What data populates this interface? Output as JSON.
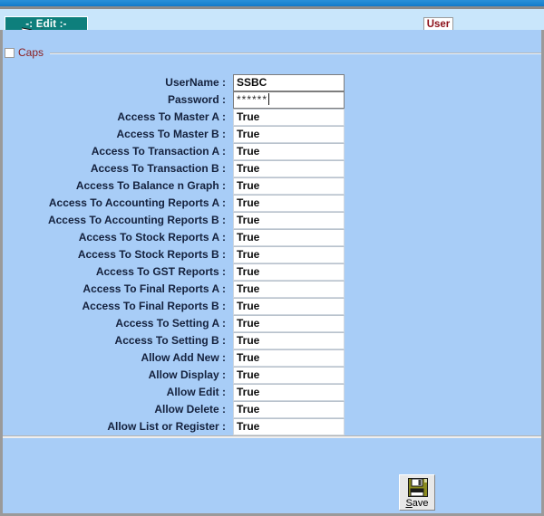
{
  "window": {
    "tab_label": "-: Edit :-",
    "entity_label": "User"
  },
  "group": {
    "caps_label": "Caps",
    "caps_checked": false
  },
  "form": {
    "fields": [
      {
        "label": "UserName :",
        "value": "SSBC",
        "type": "text"
      },
      {
        "label": "Password :",
        "value": "******",
        "type": "password"
      },
      {
        "label": "Access To Master A :",
        "value": "True",
        "type": "bool"
      },
      {
        "label": "Access To Master B :",
        "value": "True",
        "type": "bool"
      },
      {
        "label": "Access To Transaction A :",
        "value": "True",
        "type": "bool"
      },
      {
        "label": "Access To Transaction B :",
        "value": "True",
        "type": "bool"
      },
      {
        "label": "Access To Balance n Graph :",
        "value": "True",
        "type": "bool"
      },
      {
        "label": "Access To Accounting Reports A :",
        "value": "True",
        "type": "bool"
      },
      {
        "label": "Access To Accounting Reports B :",
        "value": "True",
        "type": "bool"
      },
      {
        "label": "Access To Stock Reports A :",
        "value": "True",
        "type": "bool"
      },
      {
        "label": "Access To Stock Reports B :",
        "value": "True",
        "type": "bool"
      },
      {
        "label": "Access To GST Reports :",
        "value": "True",
        "type": "bool"
      },
      {
        "label": "Access To Final Reports A :",
        "value": "True",
        "type": "bool"
      },
      {
        "label": "Access To Final Reports B :",
        "value": "True",
        "type": "bool"
      },
      {
        "label": "Access To Setting A :",
        "value": "True",
        "type": "bool"
      },
      {
        "label": "Access To Setting B :",
        "value": "True",
        "type": "bool"
      },
      {
        "label": "Allow Add New :",
        "value": "True",
        "type": "bool"
      },
      {
        "label": "Allow Display :",
        "value": "True",
        "type": "bool"
      },
      {
        "label": "Allow Edit :",
        "value": "True",
        "type": "bool"
      },
      {
        "label": "Allow Delete :",
        "value": "True",
        "type": "bool"
      },
      {
        "label": "Allow List or Register :",
        "value": "True",
        "type": "bool"
      }
    ]
  },
  "actions": {
    "save_accel": "S",
    "save_rest": "ave",
    "save_icon": "floppy-disk-icon"
  },
  "colors": {
    "titlebar": "#1d86d2",
    "tabstrip": "#c9e6fb",
    "panel": "#a8cdf7",
    "tab_active": "#0e7f7c",
    "accent_text": "#8b0f18",
    "label_text": "#14213d",
    "floppy_body": "#8a8a1f"
  }
}
